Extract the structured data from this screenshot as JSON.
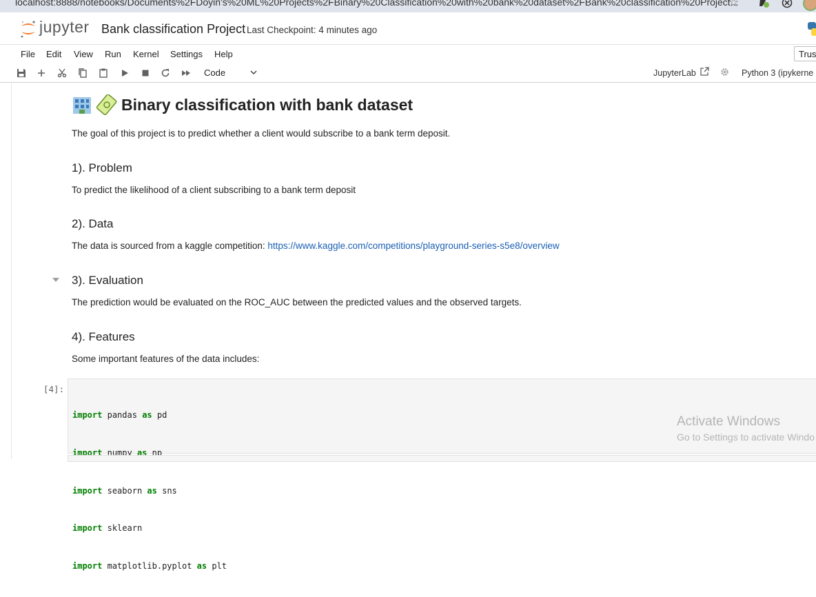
{
  "browser": {
    "url": "localhost:8888/notebooks/Documents%2FDoyin's%20ML%20Projects%2FBinary%20Classification%20with%20bank%20dataset%2FBank%20classification%20Project..."
  },
  "header": {
    "logo_text": "jupyter",
    "notebook_title": "Bank classification Project",
    "checkpoint": "Last Checkpoint: 4 minutes ago"
  },
  "menu": {
    "items": [
      "File",
      "Edit",
      "View",
      "Run",
      "Kernel",
      "Settings",
      "Help"
    ],
    "trusted": "Trus"
  },
  "toolbar": {
    "cell_type": "Code",
    "jupyterlab_label": "JupyterLab",
    "kernel": "Python 3 (ipykerne"
  },
  "notebook": {
    "title": "Binary classification with bank dataset",
    "intro": "The goal of this project is to predict whether a client would subscribe to a bank term deposit.",
    "sections": [
      {
        "heading": "1). Problem",
        "text": "To predict the likelihood of a client subscribing to a bank term deposit"
      },
      {
        "heading": "2). Data",
        "text": "The data is sourced from a kaggle competition: ",
        "link": "https://www.kaggle.com/competitions/playground-series-s5e8/overview"
      },
      {
        "heading": "3). Evaluation",
        "text": "The prediction would be evaluated on the ROC_AUC between the predicted values and the observed targets."
      },
      {
        "heading": "4). Features",
        "text": "Some important features of the data includes:"
      }
    ],
    "code_cell": {
      "prompt": "[4]:",
      "lines": [
        {
          "kw": "import",
          "mod": "pandas",
          "as": "as",
          "alias": "pd"
        },
        {
          "kw": "import",
          "mod": "numpy",
          "as": "as",
          "alias": "np"
        },
        {
          "kw": "import",
          "mod": "seaborn",
          "as": "as",
          "alias": "sns"
        },
        {
          "kw": "import",
          "mod": "sklearn",
          "as": "",
          "alias": ""
        },
        {
          "kw": "import",
          "mod": "matplotlib.pyplot",
          "as": "as",
          "alias": "plt"
        }
      ]
    }
  },
  "watermark": {
    "line1": "Activate Windows",
    "line2": "Go to Settings to activate Windo"
  },
  "colors": {
    "link": "#1a5fb4",
    "keyword": "#008000",
    "jupyter_orange": "#f37726"
  }
}
